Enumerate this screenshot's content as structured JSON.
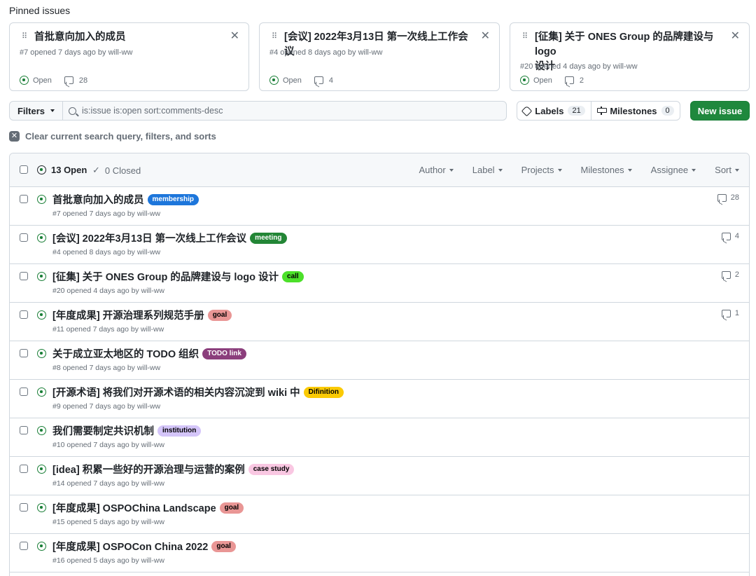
{
  "pinned": {
    "heading": "Pinned issues",
    "cards": [
      {
        "title": "首批意向加入的成员",
        "meta": "#7 opened 7 days ago by will-ww",
        "status": "Open",
        "comments": "28"
      },
      {
        "title": "[会议] 2022年3月13日 第一次线上工作会议",
        "meta": "#4 opened 8 days ago by will-ww",
        "status": "Open",
        "comments": "4"
      },
      {
        "title_line1": "[征集] 关于 ONES Group 的品牌建设与 logo",
        "title_line2": "设计",
        "meta": "#20 opened 4 days ago by will-ww",
        "status": "Open",
        "comments": "2"
      }
    ]
  },
  "toolbar": {
    "filters_label": "Filters",
    "search_value": "is:issue is:open sort:comments-desc",
    "labels_label": "Labels",
    "labels_count": "21",
    "milestones_label": "Milestones",
    "milestones_count": "0",
    "new_issue_label": "New issue"
  },
  "clear_text": "Clear current search query, filters, and sorts",
  "list_header": {
    "open_label": "13 Open",
    "closed_label": "0 Closed",
    "menus": [
      "Author",
      "Label",
      "Projects",
      "Milestones",
      "Assignee",
      "Sort"
    ]
  },
  "colors": {
    "membership": "#1d76db",
    "meeting": "#238636",
    "call": "#4ce02a",
    "goal": "#e99695",
    "todo": "#8b3e7c",
    "definition": "#fbca04",
    "institution": "#d4c5f9",
    "case_study": "#f9c7e2"
  },
  "issues": [
    {
      "title": "首批意向加入的成员",
      "label": "membership",
      "meta": "#7 opened 7 days ago by will-ww",
      "comments": "28"
    },
    {
      "title": "[会议] 2022年3月13日 第一次线上工作会议",
      "label": "meeting",
      "meta": "#4 opened 8 days ago by will-ww",
      "comments": "4"
    },
    {
      "title": "[征集] 关于 ONES Group 的品牌建设与 logo 设计",
      "label": "call",
      "meta": "#20 opened 4 days ago by will-ww",
      "comments": "2"
    },
    {
      "title": "[年度成果] 开源治理系列规范手册",
      "label": "goal",
      "meta": "#11 opened 7 days ago by will-ww",
      "comments": "1"
    },
    {
      "title": "关于成立亚太地区的 TODO 组织",
      "label": "TODO link",
      "meta": "#8 opened 7 days ago by will-ww",
      "comments": ""
    },
    {
      "title": "[开源术语] 将我们对开源术语的相关内容沉淀到 wiki 中",
      "label": "Difinition",
      "meta": "#9 opened 7 days ago by will-ww",
      "comments": ""
    },
    {
      "title": "我们需要制定共识机制",
      "label": "institution",
      "meta": "#10 opened 7 days ago by will-ww",
      "comments": ""
    },
    {
      "title": "[idea] 积累一些好的开源治理与运营的案例",
      "label": "case study",
      "meta": "#14 opened 7 days ago by will-ww",
      "comments": ""
    },
    {
      "title": "[年度成果] OSPOChina Landscape",
      "label": "goal",
      "meta": "#15 opened 5 days ago by will-ww",
      "comments": ""
    },
    {
      "title": "[年度成果] OSPOCon China 2022",
      "label": "goal",
      "meta": "#16 opened 5 days ago by will-ww",
      "comments": ""
    }
  ]
}
